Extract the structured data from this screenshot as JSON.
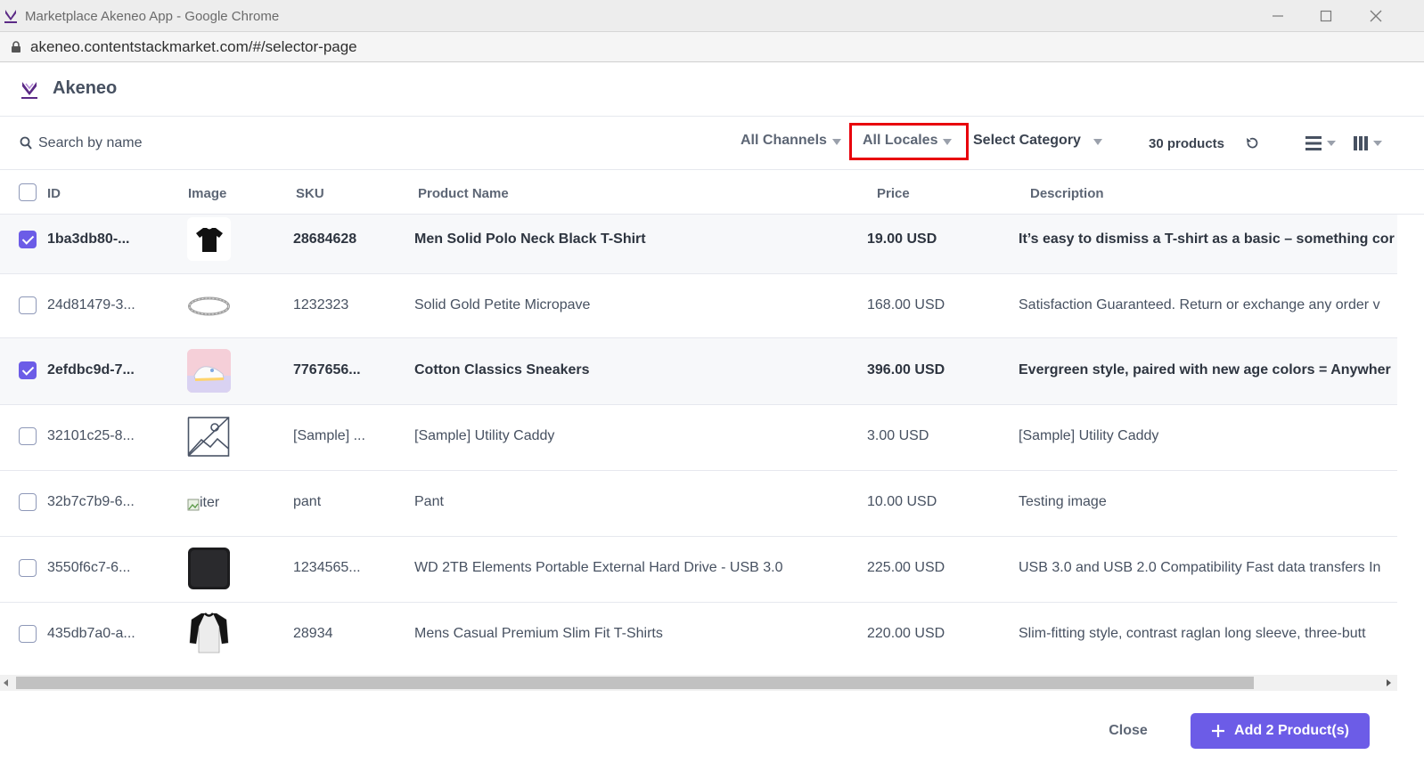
{
  "window": {
    "title": "Marketplace Akeneo App - Google Chrome",
    "url": "akeneo.contentstackmarket.com/#/selector-page"
  },
  "app": {
    "brand": "Akeneo",
    "accent": "#6c5ce7",
    "highlight": "#e8000b"
  },
  "toolbar": {
    "search_placeholder": "Search by name",
    "channels": "All Channels",
    "locales": "All Locales",
    "category": "Select Category",
    "count": "30 products"
  },
  "columns": {
    "id": "ID",
    "image": "Image",
    "sku": "SKU",
    "name": "Product Name",
    "price": "Price",
    "description": "Description"
  },
  "rows": [
    {
      "id": "1ba3db80-...",
      "image": "black-tshirt",
      "sku": "28684628",
      "name": "Men Solid Polo Neck Black T-Shirt",
      "price": "19.00 USD",
      "description": "It’s easy to dismiss a T-shirt as a basic – something cor",
      "checked": true
    },
    {
      "id": "24d81479-3...",
      "image": "silver-ring",
      "sku": "1232323",
      "name": "Solid Gold Petite Micropave",
      "price": "168.00 USD",
      "description": "Satisfaction Guaranteed. Return or exchange any order v",
      "checked": false
    },
    {
      "id": "2efdbc9d-7...",
      "image": "sneakers",
      "sku": "7767656...",
      "name": "Cotton Classics Sneakers",
      "price": "396.00 USD",
      "description": "Evergreen style, paired with new age colors = Anywher",
      "checked": true
    },
    {
      "id": "32101c25-8...",
      "image": "placeholder-image",
      "sku": "[Sample] ...",
      "name": "[Sample] Utility Caddy",
      "price": "3.00 USD",
      "description": "[Sample] Utility Caddy",
      "checked": false
    },
    {
      "id": "32b7c7b9-6...",
      "image": "broken-image",
      "image_alt": "iter",
      "sku": "pant",
      "name": "Pant",
      "price": "10.00 USD",
      "description": "Testing image",
      "checked": false
    },
    {
      "id": "3550f6c7-6...",
      "image": "hard-drive",
      "sku": "1234565...",
      "name": "WD 2TB Elements Portable External Hard Drive - USB 3.0",
      "price": "225.00 USD",
      "description": "USB 3.0 and USB 2.0 Compatibility Fast data transfers In",
      "checked": false
    },
    {
      "id": "435db7a0-a...",
      "image": "raglan-tshirt",
      "sku": "28934",
      "name": "Mens Casual Premium Slim Fit T-Shirts",
      "price": "220.00 USD",
      "description": "Slim-fitting style, contrast raglan long sleeve, three-butt",
      "checked": false
    }
  ],
  "footer": {
    "close": "Close",
    "add": "Add 2 Product(s)"
  }
}
